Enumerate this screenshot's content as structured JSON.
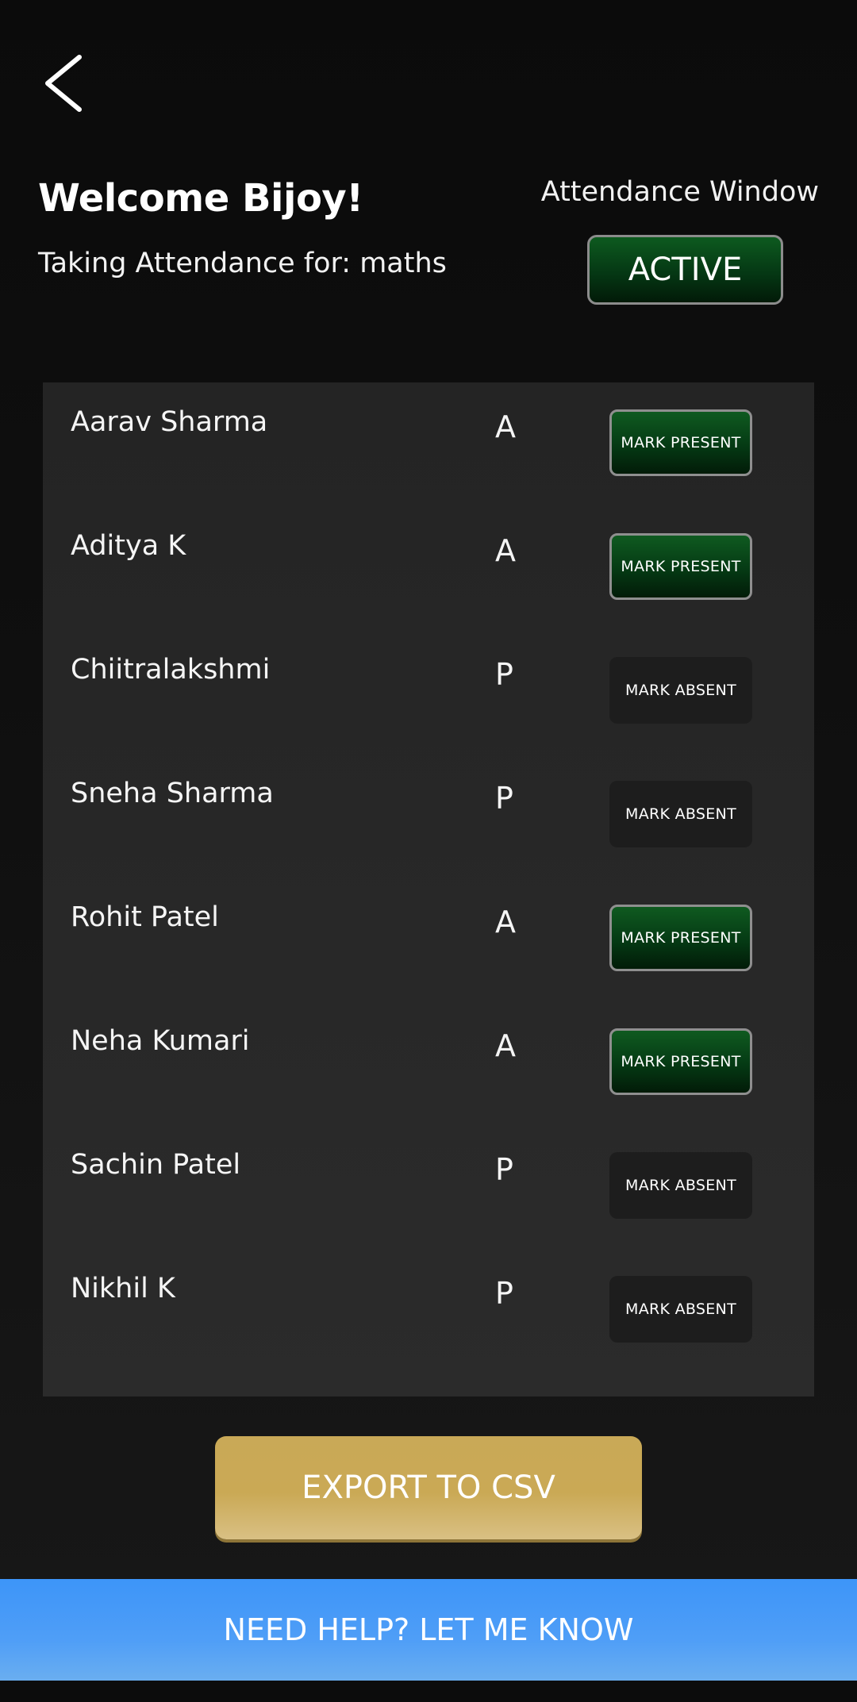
{
  "header": {
    "back_icon": "chevron-left-icon",
    "welcome": "Welcome Bijoy!",
    "subject_line": "Taking Attendance for: maths",
    "window_label": "Attendance Window",
    "window_status": "ACTIVE"
  },
  "students": [
    {
      "name": "Aarav Sharma",
      "status": "A",
      "action": "MARK PRESENT"
    },
    {
      "name": "Aditya K",
      "status": "A",
      "action": "MARK PRESENT"
    },
    {
      "name": "Chiitralakshmi",
      "status": "P",
      "action": "MARK ABSENT"
    },
    {
      "name": "Sneha Sharma",
      "status": "P",
      "action": "MARK ABSENT"
    },
    {
      "name": "Rohit Patel",
      "status": "A",
      "action": "MARK PRESENT"
    },
    {
      "name": "Neha Kumari",
      "status": "A",
      "action": "MARK PRESENT"
    },
    {
      "name": "Sachin Patel",
      "status": "P",
      "action": "MARK ABSENT"
    },
    {
      "name": "Nikhil K",
      "status": "P",
      "action": "MARK ABSENT"
    }
  ],
  "export_label": "EXPORT TO CSV",
  "help_label": "NEED HELP?  LET ME KNOW",
  "colors": {
    "active_green": "#053814",
    "export_gold": "#c9a957",
    "help_blue": "#3d95f8",
    "absent_button": "#1d1d1d"
  }
}
